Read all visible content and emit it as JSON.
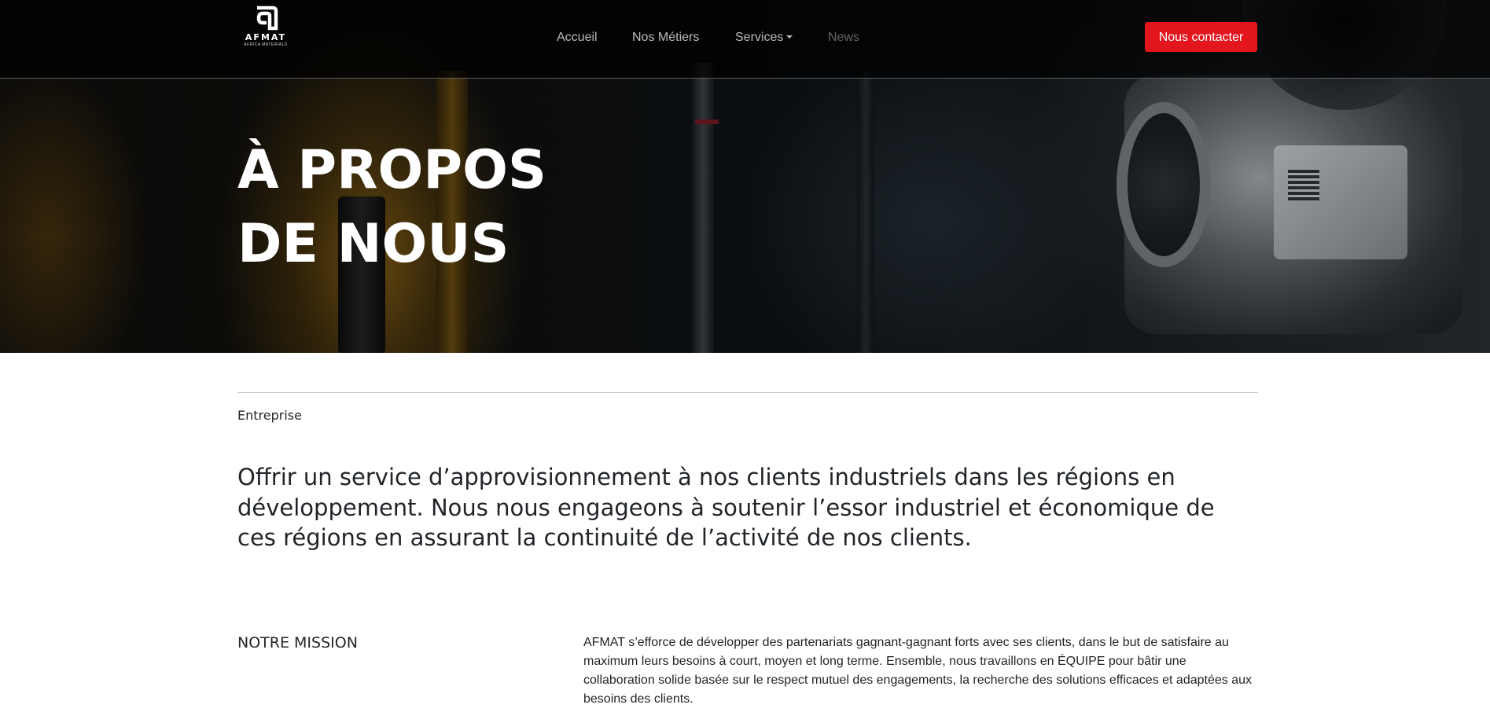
{
  "brand": {
    "name": "AFMAT",
    "tagline": "AFRICA MATERIALS"
  },
  "nav": {
    "items": [
      {
        "label": "Accueil"
      },
      {
        "label": "Nos Métiers"
      },
      {
        "label": "Services"
      },
      {
        "label": "News"
      }
    ],
    "cta_label": "Nous contacter"
  },
  "hero": {
    "title_line1": "À PROPOS",
    "title_line2": "DE NOUS"
  },
  "section": {
    "eyebrow": "Entreprise",
    "lead": "Offrir un service d’approvisionnement à nos clients industriels dans les régions en développement. Nous nous engageons à soutenir l’essor industriel et économique de ces régions en assurant la continuité de l’activité de nos clients.",
    "mission_title": "NOTRE MISSION",
    "mission_text": "AFMAT s’efforce de développer des partenariats gagnant-gagnant forts avec ses clients, dans le but de satisfaire au maximum leurs besoins à court, moyen et long terme. Ensemble, nous travaillons en ÉQUIPE pour bâtir une collaboration solide basée sur le respect mutuel des engagements, la recherche des solutions efficaces et adaptées aux besoins des clients."
  },
  "colors": {
    "accent": "#e3161e",
    "nav_bg": "#000000",
    "text": "#212529"
  },
  "icons": {
    "logo": "afmat-logo-icon",
    "dropdown": "caret-down-icon"
  }
}
